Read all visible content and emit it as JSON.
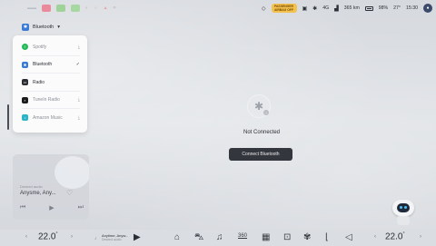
{
  "status_bar": {
    "alert_text": "PASSENGER AIRBAG OFF",
    "network": "4G",
    "range": "365 km",
    "battery": "98%",
    "temperature": "27°",
    "time": "15:30"
  },
  "source_header": {
    "label": "Bluetooth"
  },
  "menu": {
    "items": [
      {
        "label": "Spotify",
        "icon": "spotify-icon",
        "color": "#1db954",
        "trail": "download-icon"
      },
      {
        "label": "Bluetooth",
        "icon": "bluetooth-icon",
        "color": "#3a7bd5",
        "trail": "check-icon",
        "selected": true
      },
      {
        "label": "Radio",
        "icon": "radio-icon",
        "color": "#2a2d33",
        "trail": ""
      },
      {
        "label": "TuneIn Radio",
        "icon": "tunein-icon",
        "color": "#1c1c1c",
        "trail": "download-icon"
      },
      {
        "label": "Amazon Music",
        "icon": "amazon-music-icon",
        "color": "#2bb5c7",
        "trail": "download-icon"
      }
    ]
  },
  "center": {
    "status": "Not Connected",
    "button": "Connect Bluetooth"
  },
  "player": {
    "source": "Desired audio",
    "title": "Anysme, Any..."
  },
  "bottom_bar": {
    "left_temp": "22.0",
    "right_temp": "22.0",
    "degree": "°",
    "now_playing_title": "Anytime, Anyw...",
    "now_playing_sub": "Desired audio",
    "dock_label_360": "360"
  }
}
